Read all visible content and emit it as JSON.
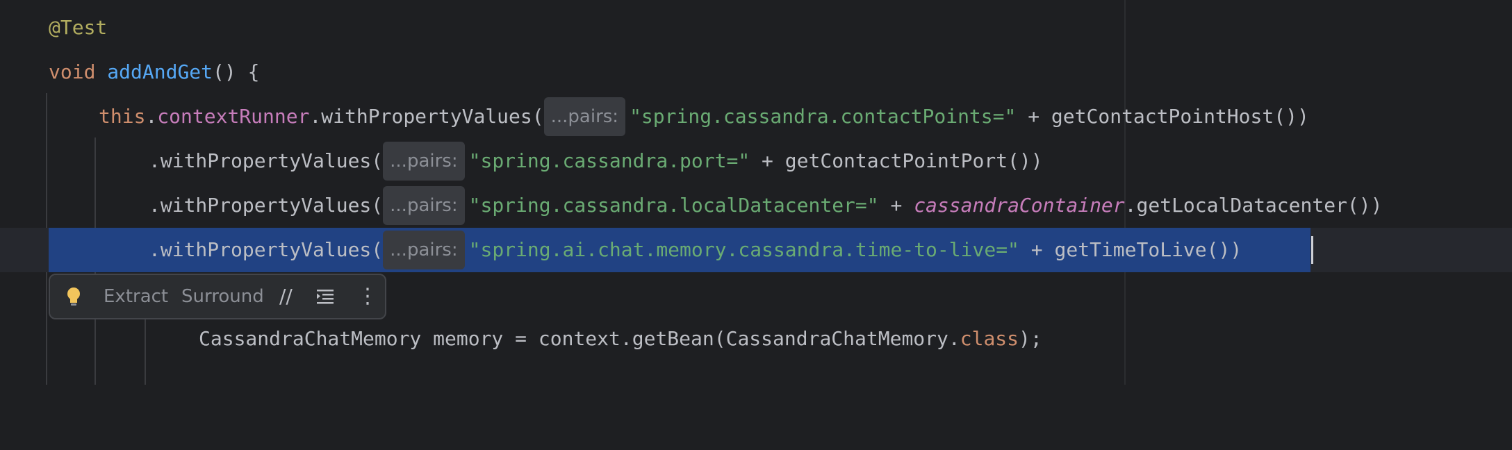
{
  "editor": {
    "lines": [
      {
        "annotation": "@Test"
      },
      {
        "keyword": "void",
        "method": "addAndGet",
        "rest": "() {"
      },
      {
        "this": "this",
        "dot": ".",
        "field": "contextRunner",
        "call": ".withPropertyValues(",
        "hint": "...pairs:",
        "string": "\"spring.cassandra.contactPoints=\"",
        "rest": " + getContactPointHost())"
      },
      {
        "call": ".withPropertyValues(",
        "hint": "...pairs:",
        "string": "\"spring.cassandra.port=\"",
        "rest": " + getContactPointPort())"
      },
      {
        "call": ".withPropertyValues(",
        "hint": "...pairs:",
        "string": "\"spring.cassandra.localDatacenter=\"",
        "plus": " + ",
        "italic": "cassandraContainer",
        "rest": ".getLocalDatacenter())"
      },
      {
        "call": ".withPropertyValues(",
        "hint": "...pairs:",
        "string": "\"spring.ai.chat.memory.cassandra.time-to-live=\"",
        "rest": " + getTimeToLive())"
      },
      {
        "text": "CassandraChatMemory memory = context.getBean(CassandraChatMemory.",
        "keyword": "class",
        "rest": ");"
      }
    ]
  },
  "context_toolbar": {
    "icon": "lightbulb-icon",
    "extract_label": "Extract",
    "surround_label": "Surround",
    "comment_label": "//",
    "more_label": "⋮"
  },
  "colors": {
    "background": "#1e1f22",
    "selection": "#214283",
    "string": "#6aab73",
    "keyword": "#cf8e6d",
    "method": "#56a8f5",
    "field": "#c77dbb",
    "annotation": "#b3ae60"
  }
}
